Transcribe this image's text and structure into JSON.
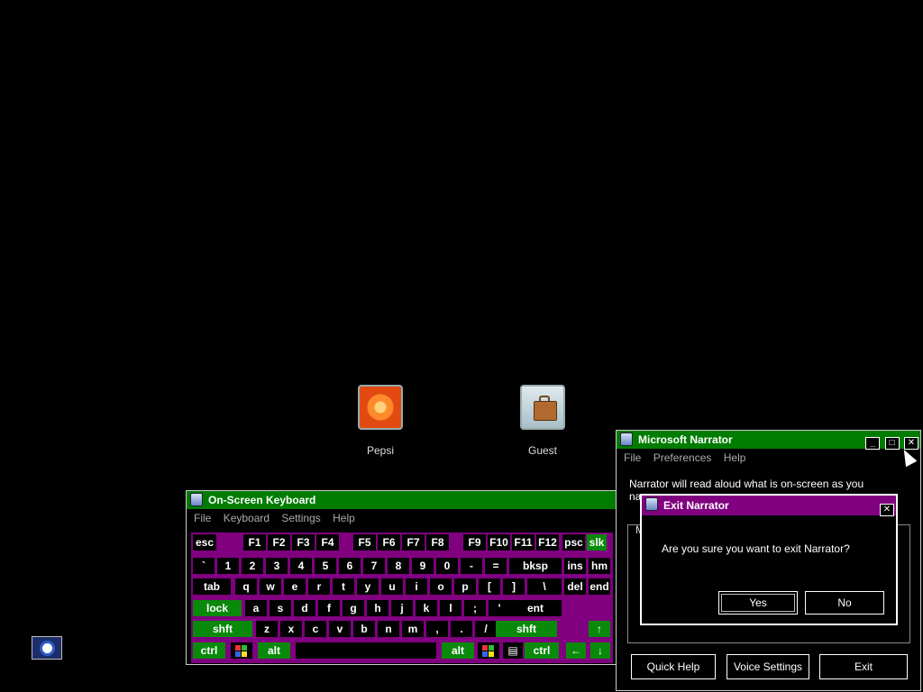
{
  "users": [
    {
      "name": "Pepsi",
      "picture_icon": "flower-icon"
    },
    {
      "name": "Guest",
      "picture_icon": "briefcase-icon"
    }
  ],
  "ease_of_access_icon": "ease-of-access-icon",
  "osk": {
    "title": "On-Screen Keyboard",
    "menu": [
      "File",
      "Keyboard",
      "Settings",
      "Help"
    ],
    "rows": {
      "fn": [
        "esc",
        "F1",
        "F2",
        "F3",
        "F4",
        "F5",
        "F6",
        "F7",
        "F8",
        "F9",
        "F10",
        "F11",
        "F12",
        "psc",
        "slk"
      ],
      "num": [
        "`",
        "1",
        "2",
        "3",
        "4",
        "5",
        "6",
        "7",
        "8",
        "9",
        "0",
        "-",
        "=",
        "bksp",
        "ins",
        "hm"
      ],
      "top": [
        "tab",
        "q",
        "w",
        "e",
        "r",
        "t",
        "y",
        "u",
        "i",
        "o",
        "p",
        "[",
        "]",
        "\\",
        "del",
        "end"
      ],
      "home": [
        "lock",
        "a",
        "s",
        "d",
        "f",
        "g",
        "h",
        "j",
        "k",
        "l",
        ";",
        "'",
        "ent"
      ],
      "bottom": [
        "shft",
        "z",
        "x",
        "c",
        "v",
        "b",
        "n",
        "m",
        ",",
        ".",
        "/",
        "shft",
        "↑"
      ],
      "space": [
        "ctrl",
        "alt",
        "alt",
        "ctrl",
        "←",
        "↓"
      ]
    },
    "accent_color": "#007c00",
    "keyboard_bg": "#800080"
  },
  "narrator": {
    "title": "Microsoft Narrator",
    "menu": [
      "File",
      "Preferences",
      "Help"
    ],
    "text_line1": "Narrator will read aloud what is on-screen as you",
    "text_line2_fragment": "na",
    "group_label_fragment": "M",
    "buttons": [
      "Quick Help",
      "Voice Settings",
      "Exit"
    ]
  },
  "dialog": {
    "title": "Exit Narrator",
    "message": "Are you sure you want to exit Narrator?",
    "yes": "Yes",
    "no": "No",
    "title_color": "#800080"
  }
}
